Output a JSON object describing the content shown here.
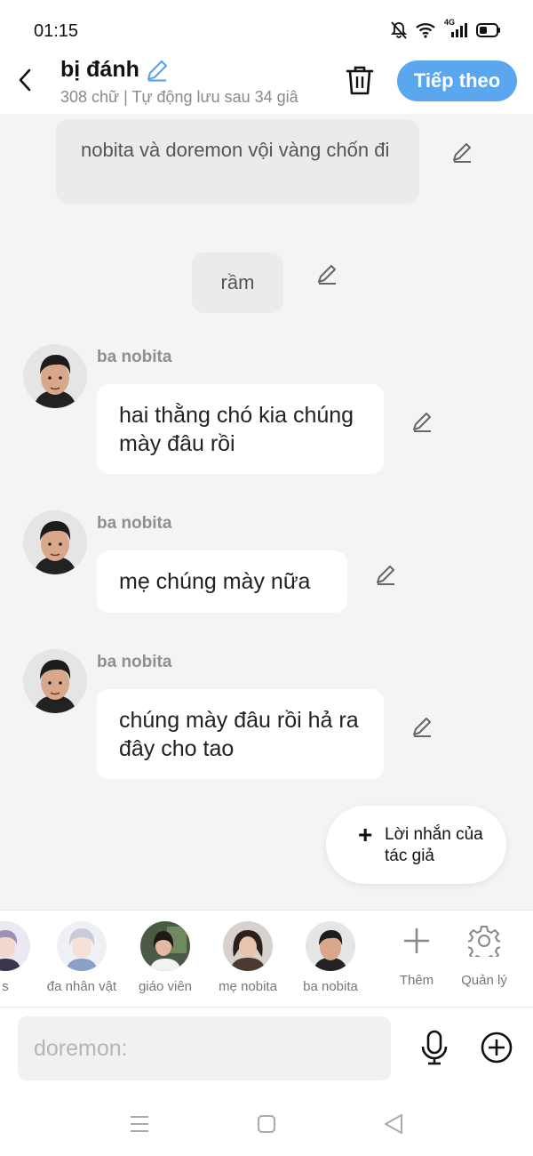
{
  "status": {
    "time": "01:15",
    "network": "4G"
  },
  "header": {
    "title": "bị đánh",
    "subtitle": "308 chữ | Tự động lưu sau 34 giâ",
    "next_label": "Tiếp theo",
    "accent": "#5aa7f0"
  },
  "chat": {
    "narrations": [
      {
        "text": "nobita và doremon vội vàng chốn đi"
      },
      {
        "text": "rầm"
      }
    ],
    "messages": [
      {
        "speaker": "ba nobita",
        "text": "hai thằng chó kia chúng mày đâu rồi"
      },
      {
        "speaker": "ba nobita",
        "text": "mẹ chúng mày nữa"
      },
      {
        "speaker": "ba nobita",
        "text": "chúng mày đâu rồi hả ra đây cho tao"
      }
    ],
    "author_note_label": "Lời nhắn của tác giả"
  },
  "characters": [
    {
      "name": "s",
      "icon": "avatar-anime-purple"
    },
    {
      "name": "đa nhân vật",
      "icon": "avatar-anime-silver"
    },
    {
      "name": "giáo viên",
      "icon": "avatar-teacher"
    },
    {
      "name": "mẹ nobita",
      "icon": "avatar-woman"
    },
    {
      "name": "ba nobita",
      "icon": "avatar-man"
    }
  ],
  "tools": {
    "add_label": "Thêm",
    "manage_label": "Quản lý"
  },
  "input": {
    "placeholder": "doremon:"
  }
}
